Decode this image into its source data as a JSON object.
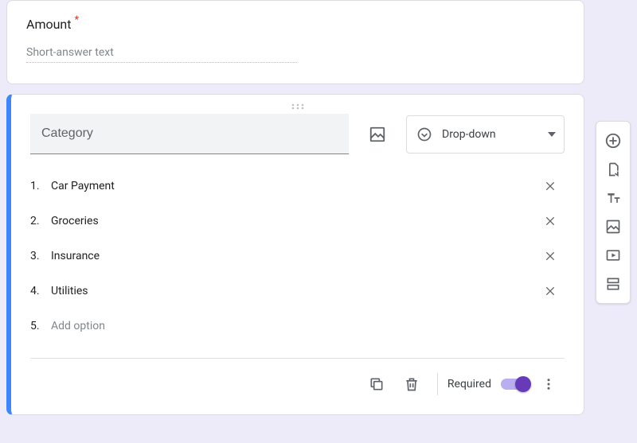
{
  "question1": {
    "title": "Amount",
    "required_marker": "*",
    "placeholder": "Short-answer text"
  },
  "question2": {
    "title": "Category",
    "type_label": "Drop-down",
    "options": [
      {
        "num": "1.",
        "label": "Car Payment"
      },
      {
        "num": "2.",
        "label": "Groceries"
      },
      {
        "num": "3.",
        "label": "Insurance"
      },
      {
        "num": "4.",
        "label": "Utilities"
      }
    ],
    "add_option_num": "5.",
    "add_option_label": "Add option",
    "footer": {
      "required_label": "Required",
      "required_on": true
    }
  }
}
